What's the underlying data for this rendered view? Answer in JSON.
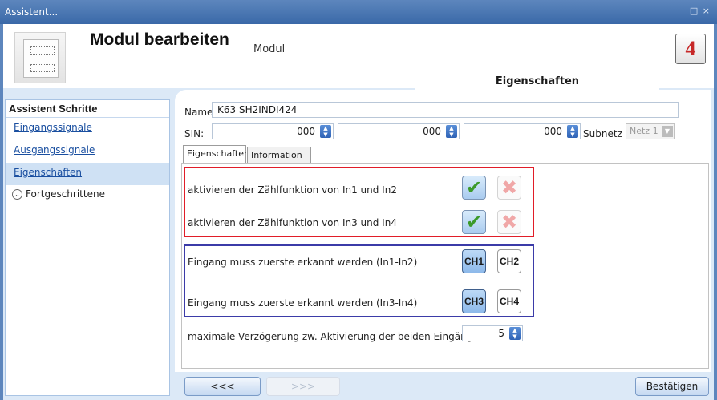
{
  "window": {
    "title": "Assistent...",
    "controls": "□ ×"
  },
  "header": {
    "title": "Modul bearbeiten",
    "subtitle": "Modul",
    "props_tab": "Eigenschaften",
    "logo": "4"
  },
  "sidebar": {
    "heading": "Assistent Schritte",
    "items": [
      {
        "label": "Eingangssignale"
      },
      {
        "label": "Ausgangssignale"
      },
      {
        "label": "Eigenschaften"
      }
    ],
    "advanced": "Fortgeschrittene"
  },
  "form": {
    "name_label": "Name",
    "name_value": "K63 SH2INDI424",
    "sin_label": "SIN:",
    "sin_values": [
      "000",
      "000",
      "000"
    ],
    "subnet_label": "Subnetz",
    "subnet_value": "Netz 1"
  },
  "tabs": [
    {
      "label": "Eigenschaften"
    },
    {
      "label": "Information"
    }
  ],
  "count_options": [
    {
      "label": "aktivieren der Zählfunktion von In1 und In2"
    },
    {
      "label": "aktivieren der Zählfunktion von In3 und In4"
    }
  ],
  "channel_options": [
    {
      "label": "Eingang muss zuerste erkannt werden (In1-In2)",
      "a": "CH1",
      "b": "CH2"
    },
    {
      "label": "Eingang muss zuerste erkannt werden (In3-In4)",
      "a": "CH3",
      "b": "CH4"
    }
  ],
  "delay": {
    "label": "maximale Verzögerung zw. Aktivierung der beiden Eingänge (s)",
    "value": "5"
  },
  "footer": {
    "back": "<<<",
    "next": ">>>",
    "confirm": "Bestätigen"
  },
  "colors": {
    "highlight_red": "#e11d28",
    "highlight_blue": "#3b3ba8",
    "accent": "#5d86bd"
  }
}
